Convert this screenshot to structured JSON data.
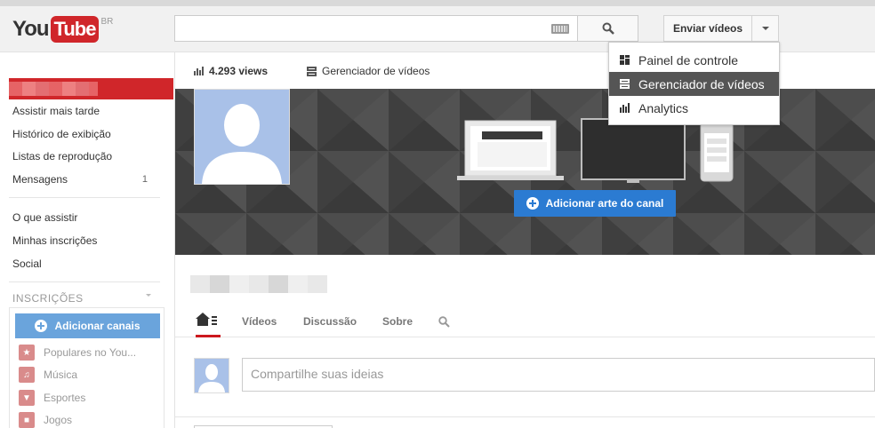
{
  "header": {
    "logo_you": "You",
    "logo_tube": "Tube",
    "region": "BR",
    "search": {
      "value": "",
      "placeholder": ""
    },
    "upload_label": "Enviar vídeos"
  },
  "upload_menu": {
    "items": [
      {
        "label": "Painel de controle",
        "icon": "dashboard-icon",
        "active": false
      },
      {
        "label": "Gerenciador de vídeos",
        "icon": "video-manager-icon",
        "active": true
      },
      {
        "label": "Analytics",
        "icon": "analytics-icon",
        "active": false
      }
    ]
  },
  "sidebar": {
    "links": [
      {
        "label": "Assistir mais tarde",
        "count": ""
      },
      {
        "label": "Histórico de exibição",
        "count": ""
      },
      {
        "label": "Listas de reprodução",
        "count": ""
      },
      {
        "label": "Mensagens",
        "count": "1"
      }
    ],
    "links2": [
      {
        "label": "O que assistir"
      },
      {
        "label": "Minhas inscrições"
      },
      {
        "label": "Social"
      }
    ],
    "subscriptions_heading": "INSCRIÇÕES",
    "add_channels_label": "Adicionar canais",
    "subscriptions": [
      {
        "label": "Populares no You...",
        "icon": "star-icon"
      },
      {
        "label": "Música",
        "icon": "headphones-icon"
      },
      {
        "label": "Esportes",
        "icon": "trophy-icon"
      },
      {
        "label": "Jogos",
        "icon": "gamepad-icon"
      }
    ]
  },
  "channel": {
    "views": "4.293 views",
    "video_manager_label": "Gerenciador de vídeos",
    "add_art_label": "Adicionar arte do canal",
    "tabs": [
      "Vídeos",
      "Discussão",
      "Sobre"
    ],
    "share_placeholder": "Compartilhe suas ideias"
  },
  "colors": {
    "brand_red": "#cc181e",
    "accent_blue": "#2b7bd2",
    "menu_active": "#555555"
  }
}
